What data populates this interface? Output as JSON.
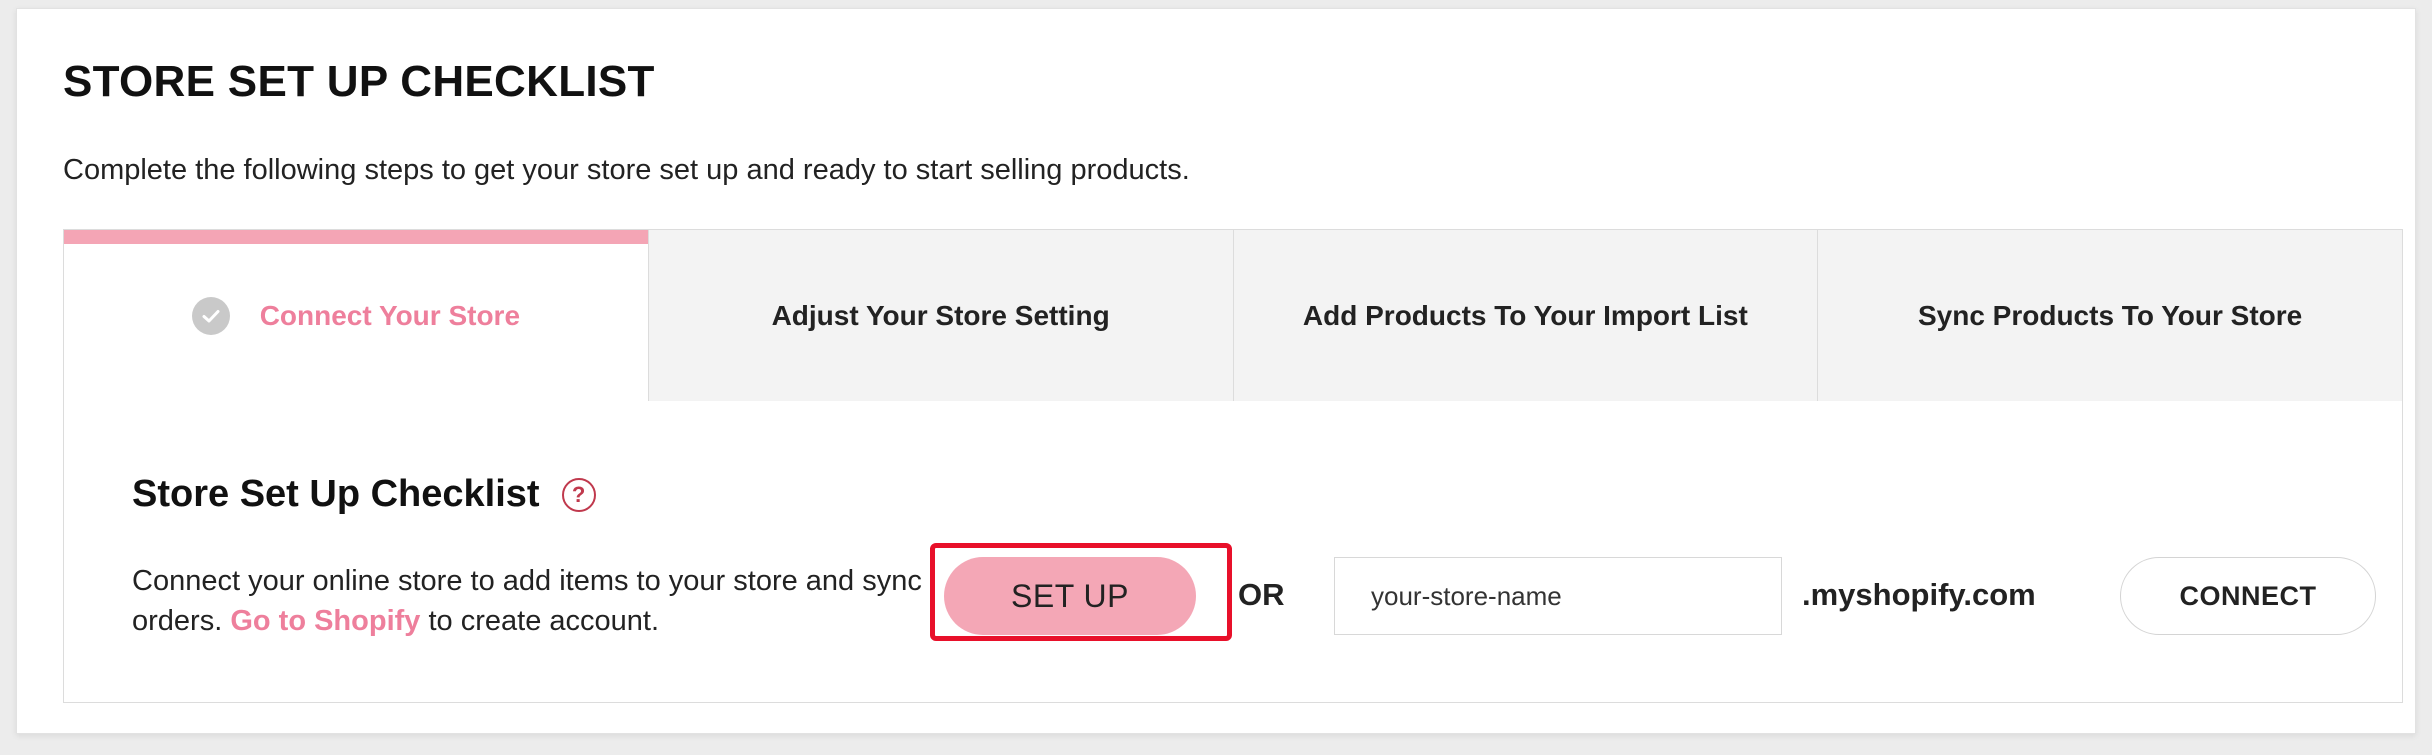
{
  "header": {
    "title": "STORE SET UP CHECKLIST",
    "description": "Complete the following steps to get your store set up and ready to start selling products."
  },
  "tabs": [
    {
      "label": "Connect Your Store",
      "active": true,
      "icon": "check-circle-icon"
    },
    {
      "label": "Adjust Your Store Setting",
      "active": false
    },
    {
      "label": "Add Products To Your Import List",
      "active": false
    },
    {
      "label": "Sync Products To Your Store",
      "active": false
    }
  ],
  "panel": {
    "title": "Store Set Up Checklist",
    "help_icon": "question-circle-icon",
    "text_before_link": "Connect your online store to add items to your store and sync orders. ",
    "link_text": "Go to Shopify",
    "text_after_link": " to create account.",
    "setup_label": "SET UP",
    "or_label": "OR",
    "store_input_value": "your-store-name",
    "domain_suffix": ".myshopify.com",
    "connect_label": "CONNECT"
  },
  "colors": {
    "accent_pink": "#ee7f9c",
    "button_pink": "#f4a7b6",
    "highlight_red": "#e8102a"
  }
}
